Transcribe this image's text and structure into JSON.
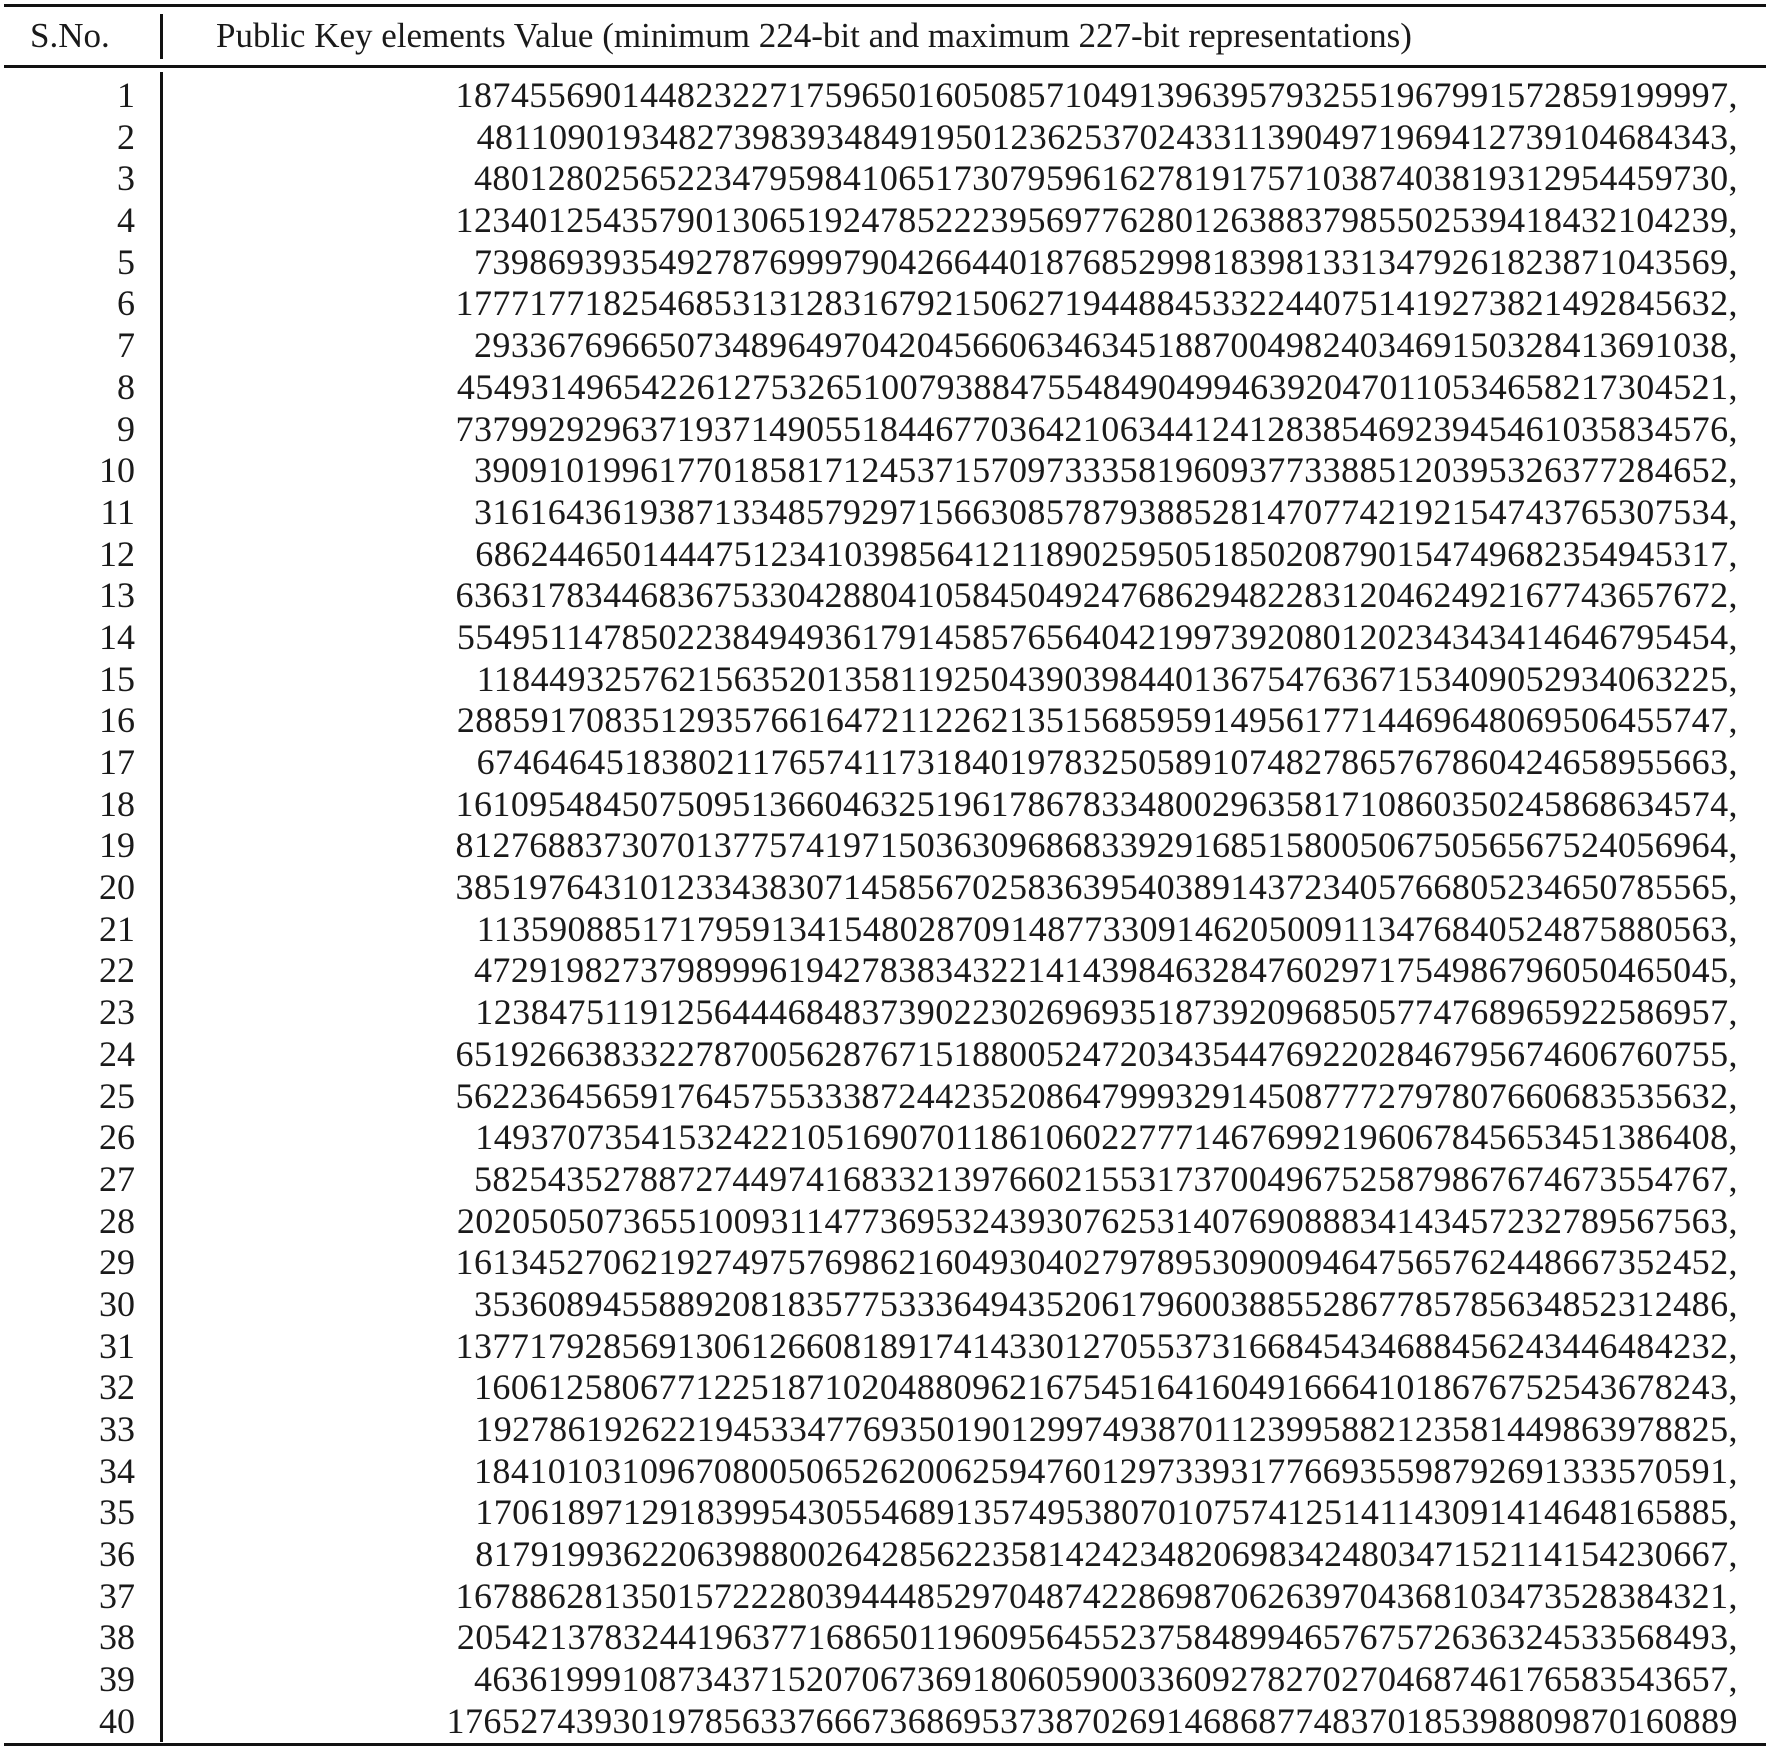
{
  "table": {
    "header": {
      "sno": "S.No.",
      "value": "Public Key elements Value (minimum 224-bit and maximum 227-bit representations)"
    },
    "rows": [
      {
        "sno": "1",
        "value": "187455690144823227175965016050857104913963957932551967991572859199997,"
      },
      {
        "sno": "2",
        "value": "48110901934827398393484919501236253702433113904971969412739104684343,"
      },
      {
        "sno": "3",
        "value": "48012802565223479598410651730795961627819175710387403819312954459730,"
      },
      {
        "sno": "4",
        "value": "123401254357901306519247852223956977628012638837985502539418432104239,"
      },
      {
        "sno": "5",
        "value": "73986939354927876999790426644018768529981839813313479261823871043569,"
      },
      {
        "sno": "6",
        "value": "177717718254685313128316792150627194488453322440751419273821492845632,"
      },
      {
        "sno": "7",
        "value": "29336769665073489649704204566063463451887004982403469150328413691038,"
      },
      {
        "sno": "8",
        "value": "454931496542261275326510079388475548490499463920470110534658217304521,"
      },
      {
        "sno": "9",
        "value": "737992929637193714905518446770364210634412412838546923945461035834576,"
      },
      {
        "sno": "10",
        "value": "39091019961770185817124537157097333581960937733885120395326377284652,"
      },
      {
        "sno": "11",
        "value": "31616436193871334857929715663085787938852814707742192154743765307534,"
      },
      {
        "sno": "12",
        "value": "68624465014447512341039856412118902595051850208790154749682354945317,"
      },
      {
        "sno": "13",
        "value": "636317834468367533042880410584504924768629482283120462492167743657672,"
      },
      {
        "sno": "14",
        "value": "554951147850223849493617914585765640421997392080120234343414646795454,"
      },
      {
        "sno": "15",
        "value": "11844932576215635201358119250439039844013675476367153409052934063225,"
      },
      {
        "sno": "16",
        "value": "288591708351293576616472112262135156859591495617714469648069506455747,"
      },
      {
        "sno": "17",
        "value": "67464645183802117657411731840197832505891074827865767860424658955663,"
      },
      {
        "sno": "18",
        "value": "161095484507509513660463251961786783348002963581710860350245868634574,"
      },
      {
        "sno": "19",
        "value": "812768837307013775741971503630968683392916851580050675056567524056964,"
      },
      {
        "sno": "20",
        "value": "385197643101233438307145856702583639540389143723405766805234650785565,"
      },
      {
        "sno": "21",
        "value": "11359088517179591341548028709148773309146205009113476840524875880563,"
      },
      {
        "sno": "22",
        "value": "47291982737989996194278383432214143984632847602971754986796050465045,"
      },
      {
        "sno": "23",
        "value": "12384751191256444684837390223026969351873920968505774768965922586957,"
      },
      {
        "sno": "24",
        "value": "651926638332278700562876715188005247203435447692202846795674606760755,"
      },
      {
        "sno": "25",
        "value": "562236456591764575533387244235208647999329145087772797807660683535632,"
      },
      {
        "sno": "26",
        "value": "14937073541532422105169070118610602277714676992196067845653451386408,"
      },
      {
        "sno": "27",
        "value": "58254352788727449741683321397660215531737004967525879867674673554767,"
      },
      {
        "sno": "28",
        "value": "202050507365510093114773695324393076253140769088834143457232789567563,"
      },
      {
        "sno": "29",
        "value": "161345270621927497576986216049304027978953090094647565762448667352452,"
      },
      {
        "sno": "30",
        "value": "35360894558892081835775333649435206179600388552867785785634852312486,"
      },
      {
        "sno": "31",
        "value": "137717928569130612660818917414330127055373166845434688456243446484232,"
      },
      {
        "sno": "32",
        "value": "16061258067712251871020488096216754516416049166641018676752543678243,"
      },
      {
        "sno": "33",
        "value": "19278619262219453347769350190129974938701123995882123581449863978825,"
      },
      {
        "sno": "34",
        "value": "18410103109670800506526200625947601297339317766935598792691333570591,"
      },
      {
        "sno": "35",
        "value": "17061897129183995430554689135749538070107574125141143091414648165885,"
      },
      {
        "sno": "36",
        "value": "81791993622063988002642856223581424234820698342480347152114154230667,"
      },
      {
        "sno": "37",
        "value": "167886281350157222803944485297048742286987062639704368103473528384321,"
      },
      {
        "sno": "38",
        "value": "205421378324419637716865011960956455237584899465767572636324533568493,"
      },
      {
        "sno": "39",
        "value": "46361999108734371520706736918060590033609278270270468746176583543657,"
      },
      {
        "sno": "40",
        "value": "1765274393019785633766673686953738702691468687748370185398809870160889"
      }
    ]
  }
}
